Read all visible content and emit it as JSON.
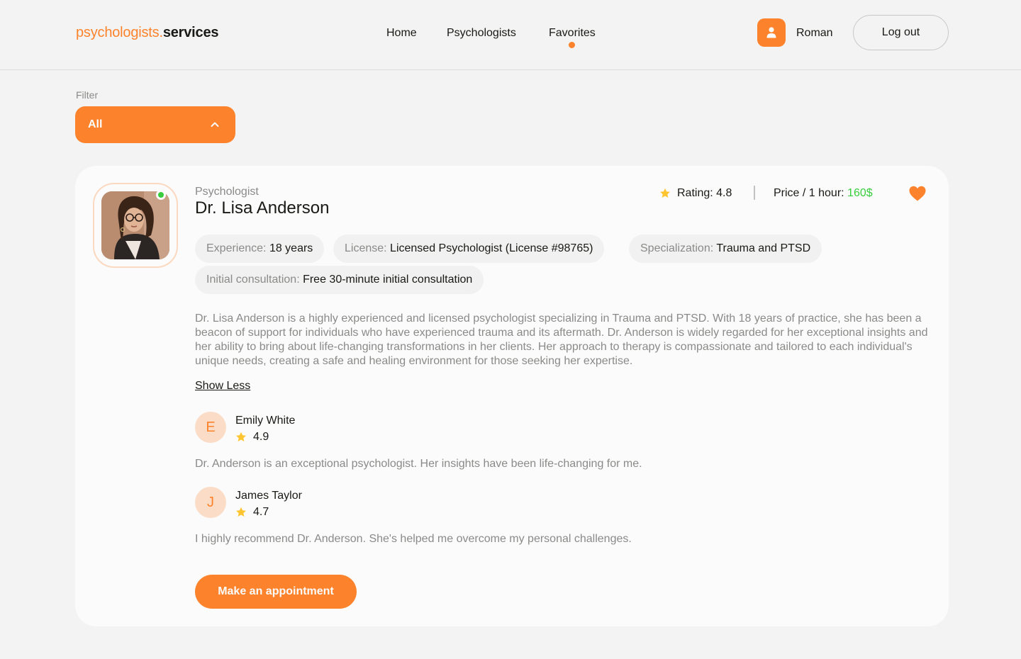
{
  "header": {
    "logo_primary": "psychologists.",
    "logo_secondary": "services",
    "nav": [
      {
        "label": "Home"
      },
      {
        "label": "Psychologists"
      },
      {
        "label": "Favorites"
      }
    ],
    "user_name": "Roman",
    "logout_label": "Log out",
    "user_icon": "user-icon"
  },
  "filter": {
    "label": "Filter",
    "selected": "All",
    "icon": "chevron-up-icon"
  },
  "card": {
    "role": "Psychologist",
    "name": "Dr. Lisa Anderson",
    "rating_label": "Rating: 4.8",
    "price_label": "Price / 1 hour: ",
    "price_value": "160$",
    "favorite": true,
    "chips": [
      {
        "key": "Experience: ",
        "value": "18 years"
      },
      {
        "key": "License: ",
        "value": "Licensed Psychologist (License #98765)"
      },
      {
        "key": "Specialization: ",
        "value": "Trauma and PTSD"
      },
      {
        "key": "Initial consultation: ",
        "value": "Free 30-minute initial consultation"
      }
    ],
    "about": "Dr. Lisa Anderson is a highly experienced and licensed psychologist specializing in Trauma and PTSD. With 18 years of practice, she has been a beacon of support for individuals who have experienced trauma and its aftermath. Dr. Anderson is widely regarded for her exceptional insights and her ability to bring about life-changing transformations in her clients. Her approach to therapy is compassionate and tailored to each individual's unique needs, creating a safe and healing environment for those seeking her expertise.",
    "show_less": "Show Less",
    "reviews": [
      {
        "initial": "E",
        "name": "Emily White",
        "rating": "4.9",
        "comment": "Dr. Anderson is an exceptional psychologist. Her insights have been life-changing for me."
      },
      {
        "initial": "J",
        "name": "James Taylor",
        "rating": "4.7",
        "comment": "I highly recommend Dr. Anderson. She's helped me overcome my personal challenges."
      }
    ],
    "appointment_label": "Make an appointment"
  },
  "colors": {
    "accent": "#fc832c",
    "green": "#38cd3e",
    "star": "#ffc531",
    "muted_text": "#8a8a89",
    "background": "#f3f3f3",
    "card": "#fbfbfb"
  }
}
